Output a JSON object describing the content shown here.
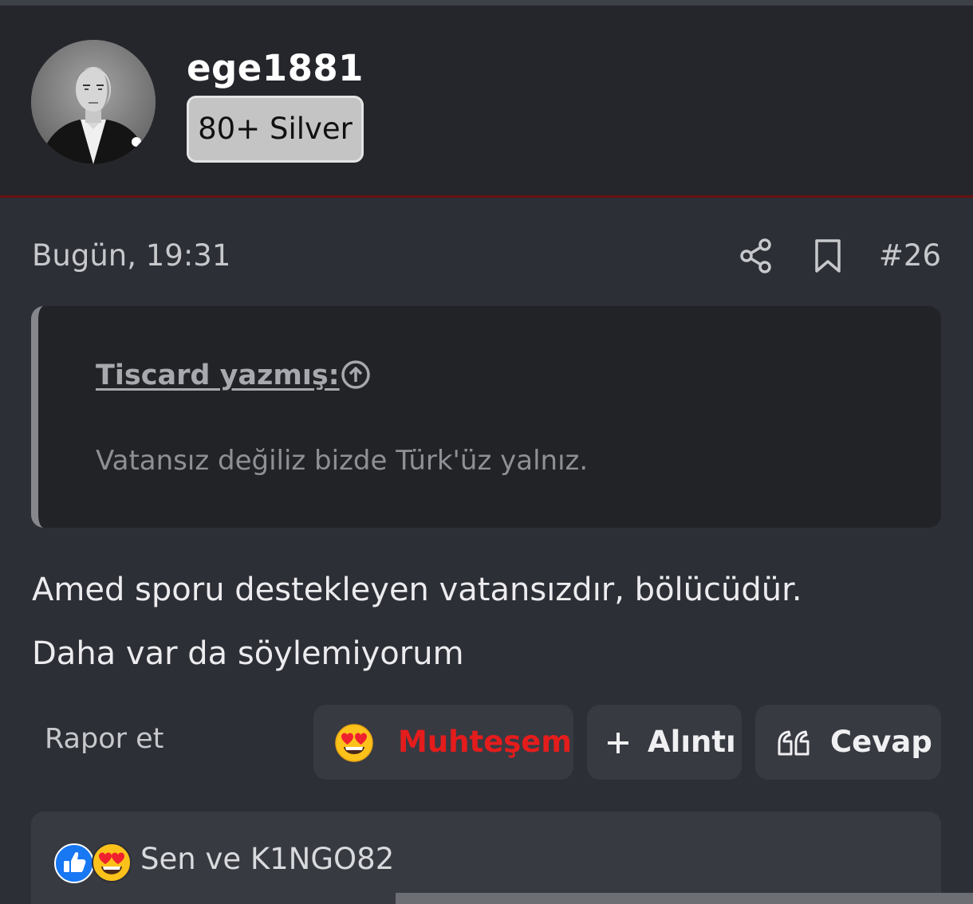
{
  "author": {
    "username": "ege1881",
    "rank_badge": "80+ Silver"
  },
  "post": {
    "date": "Bugün, 19:31",
    "number": "#26",
    "quote": {
      "author_link": "Tiscard yazmış:",
      "text": "Vatansız değiliz bizde Türk'üz yalnız."
    },
    "body_lines": [
      "Amed sporu destekleyen vatansızdır, bölücüdür.",
      "Daha var da söylemiyorum"
    ]
  },
  "actions": {
    "report": "Rapor et",
    "reaction_label": "Muhteşem",
    "quote_label": "Alıntı",
    "reply_label": "Cevap"
  },
  "reactions": {
    "summary": "Sen ve K1NGO82"
  },
  "colors": {
    "background": "#2d2f36",
    "header_background": "#25262b",
    "accent_divider": "#6a1212",
    "reaction_red": "#e51c1c",
    "button_background": "#383a42",
    "quote_background": "#222327"
  },
  "icons": {
    "share": "share-icon",
    "bookmark": "bookmark-icon",
    "quote_jump": "arrow-up-circle-icon",
    "reaction": "heart-eyes-emoji-icon",
    "quote_plus": "plus-icon",
    "reply": "quotation-marks-icon",
    "like": "thumbs-up-icon"
  }
}
